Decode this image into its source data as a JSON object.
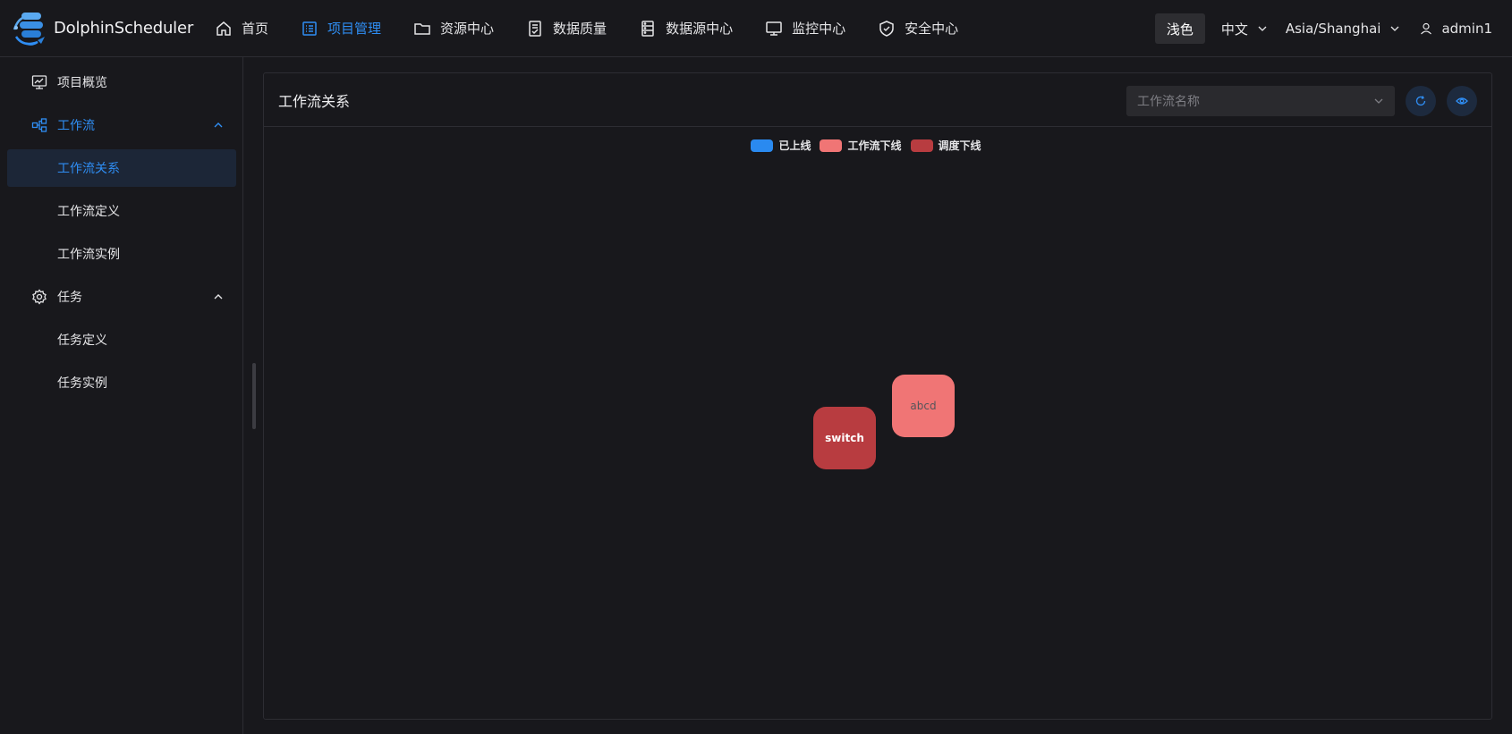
{
  "app": {
    "name": "DolphinScheduler"
  },
  "nav": {
    "items": [
      {
        "label": "首页",
        "icon": "home-icon",
        "active": false
      },
      {
        "label": "项目管理",
        "icon": "project-list-icon",
        "active": true
      },
      {
        "label": "资源中心",
        "icon": "folder-icon",
        "active": false
      },
      {
        "label": "数据质量",
        "icon": "document-check-icon",
        "active": false
      },
      {
        "label": "数据源中心",
        "icon": "datasource-icon",
        "active": false
      },
      {
        "label": "监控中心",
        "icon": "monitor-icon",
        "active": false
      },
      {
        "label": "安全中心",
        "icon": "shield-icon",
        "active": false
      }
    ]
  },
  "header_right": {
    "theme_label": "浅色",
    "language": "中文",
    "timezone": "Asia/Shanghai",
    "username": "admin1"
  },
  "sidebar": {
    "overview": {
      "label": "项目概览",
      "icon": "chart-monitor-icon"
    },
    "workflow": {
      "label": "工作流",
      "icon": "workflow-icon",
      "expanded": true,
      "children": [
        {
          "label": "工作流关系",
          "selected": true
        },
        {
          "label": "工作流定义",
          "selected": false
        },
        {
          "label": "工作流实例",
          "selected": false
        }
      ]
    },
    "task": {
      "label": "任务",
      "icon": "gear-icon",
      "expanded": true,
      "children": [
        {
          "label": "任务定义",
          "selected": false
        },
        {
          "label": "任务实例",
          "selected": false
        }
      ]
    }
  },
  "main": {
    "title": "工作流关系",
    "workflow_select_placeholder": "工作流名称",
    "legend": [
      {
        "label": "已上线",
        "color": "#2a8af0"
      },
      {
        "label": "工作流下线",
        "color": "#f07575"
      },
      {
        "label": "调度下线",
        "color": "#b83c40"
      }
    ],
    "nodes": [
      {
        "label": "switch",
        "status": "调度下线",
        "color": "#b83c40"
      },
      {
        "label": "abcd",
        "status": "工作流下线",
        "color": "#f07575"
      }
    ]
  },
  "colors": {
    "accent": "#2f8ef4",
    "background": "#18181c",
    "border": "#2d2d33"
  }
}
